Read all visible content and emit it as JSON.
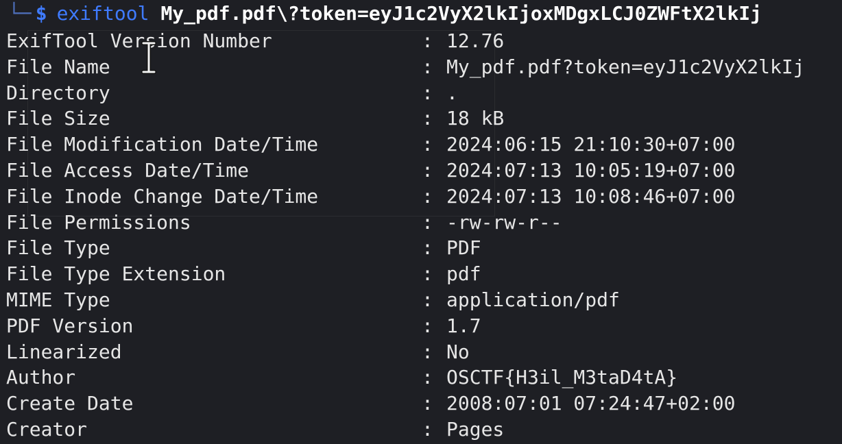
{
  "prompt": {
    "tree_glyph": "└─",
    "symbol": "$",
    "command": "exiftool",
    "argument": "My_pdf.pdf\\?token=eyJ1c2VyX2lkIjoxMDgxLCJ0ZWFtX2lkIj"
  },
  "separator": ":",
  "rows": [
    {
      "key": "ExifTool Version Number",
      "value": "12.76"
    },
    {
      "key": "File Name",
      "value": "My_pdf.pdf?token=eyJ1c2VyX2lkIj"
    },
    {
      "key": "Directory",
      "value": "."
    },
    {
      "key": "File Size",
      "value": "18 kB"
    },
    {
      "key": "File Modification Date/Time",
      "value": "2024:06:15 21:10:30+07:00"
    },
    {
      "key": "File Access Date/Time",
      "value": "2024:07:13 10:05:19+07:00"
    },
    {
      "key": "File Inode Change Date/Time",
      "value": "2024:07:13 10:08:46+07:00"
    },
    {
      "key": "File Permissions",
      "value": "-rw-rw-r--"
    },
    {
      "key": "File Type",
      "value": "PDF"
    },
    {
      "key": "File Type Extension",
      "value": "pdf"
    },
    {
      "key": "MIME Type",
      "value": "application/pdf"
    },
    {
      "key": "PDF Version",
      "value": "1.7"
    },
    {
      "key": "Linearized",
      "value": "No"
    },
    {
      "key": "Author",
      "value": "OSCTF{H3il_M3taD4tA}"
    },
    {
      "key": "Create Date",
      "value": "2008:07:01 07:24:47+02:00"
    },
    {
      "key": "Creator",
      "value": "Pages"
    }
  ],
  "colors": {
    "background": "#1e1f24",
    "prompt_blue": "#3f7bff",
    "text": "#e6e6e6"
  },
  "icons": {
    "cursor": "text-cursor-icon"
  }
}
